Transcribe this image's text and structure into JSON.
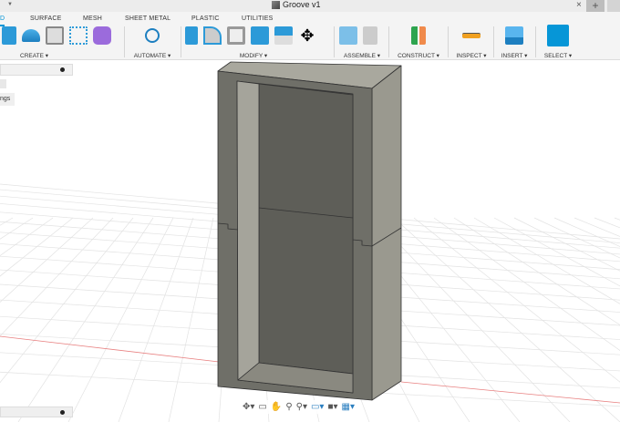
{
  "window": {
    "title": "Groove v1",
    "close_label": "×",
    "new_tab_label": "+"
  },
  "tabs": [
    {
      "label": "D",
      "active": true
    },
    {
      "label": "SURFACE"
    },
    {
      "label": "MESH"
    },
    {
      "label": "SHEET METAL"
    },
    {
      "label": "PLASTIC"
    },
    {
      "label": "UTILITIES"
    }
  ],
  "groups": [
    {
      "label": "CREATE ▾",
      "icons": [
        "extrude-icon",
        "revolve-icon",
        "hole-icon",
        "sketch-pattern-icon",
        "form-icon"
      ]
    },
    {
      "label": "AUTOMATE ▾",
      "icons": [
        "automate-icon"
      ]
    },
    {
      "label": "MODIFY ▾",
      "icons": [
        "press-pull-icon",
        "fillet-icon",
        "shell-icon",
        "combine-icon",
        "split-icon",
        "move-icon"
      ]
    },
    {
      "label": "ASSEMBLE ▾",
      "icons": [
        "new-component-icon",
        "joint-icon"
      ]
    },
    {
      "label": "CONSTRUCT ▾",
      "icons": [
        "plane-icon"
      ]
    },
    {
      "label": "INSPECT ▾",
      "icons": [
        "measure-icon"
      ]
    },
    {
      "label": "INSERT ▾",
      "icons": [
        "insert-image-icon"
      ]
    },
    {
      "label": "SELECT ▾",
      "icons": [
        "select-icon"
      ]
    }
  ],
  "browser": {
    "settings_label": "ngs"
  },
  "colors": {
    "accent": "#0696d7",
    "axis_red": "#e88080"
  }
}
